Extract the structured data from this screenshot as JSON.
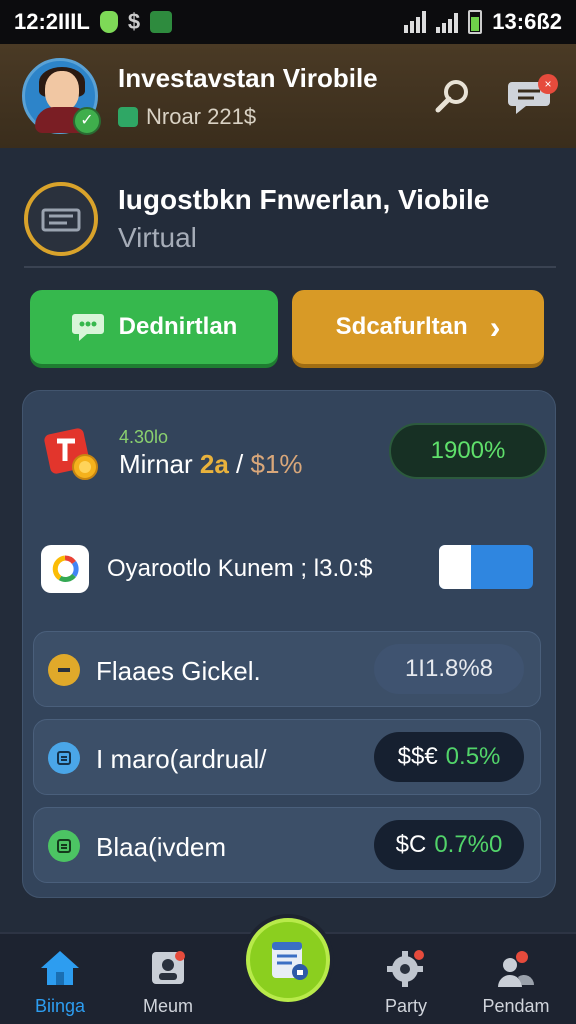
{
  "status_bar": {
    "time_left": "12:2IIIL",
    "time_right": "13:6ß2",
    "icons": [
      "shield-icon",
      "dollar-icon",
      "chart-icon",
      "wifi-signal-icon",
      "cell-signal-icon",
      "battery-icon"
    ]
  },
  "header": {
    "title": "Investavstan Virobile",
    "subtitle": "Nroar 221$",
    "icons": [
      "search-icon",
      "chat-icon"
    ],
    "chat_badge": "×"
  },
  "account": {
    "title": "Iugostbkn Fnwerlan, Viobile",
    "subtitle": "Virtual"
  },
  "actions": {
    "primary_label": "Dednirtlan",
    "secondary_label": "Sdcafurltan",
    "secondary_arrow": "›"
  },
  "card": {
    "row1": {
      "small": "4.30lo",
      "main_prefix": "Mirnar ",
      "main_accent": "2a",
      "main_sep": " / ",
      "main_suffix": "$1%",
      "pct": "1900%"
    },
    "row2": {
      "label": "Oyarootlo Kunem ; l3.0:$",
      "toggle_on": true
    },
    "list": [
      {
        "label": "Flaaes Gickel.",
        "value": "1I1.8%8",
        "style": "plain",
        "icon_color": "#e0a92a"
      },
      {
        "label": "I maro(ardrual/",
        "value_prefix": "$$€",
        "value_accent": "0.5%",
        "style": "dark",
        "icon_color": "#4aa6e8"
      },
      {
        "label": "Blaa(ivdem",
        "value_prefix": "$C",
        "value_accent": "0.7%0",
        "style": "dark",
        "icon_color": "#4cc463"
      }
    ]
  },
  "bottom_nav": {
    "items": [
      {
        "label": "Biinga",
        "icon": "home-icon",
        "active": true
      },
      {
        "label": "Meum",
        "icon": "inbox-icon",
        "active": false
      },
      {
        "label": "Party",
        "icon": "gear-icon",
        "active": false
      },
      {
        "label": "Pendam",
        "icon": "people-icon",
        "active": false
      }
    ],
    "fab_icon": "document-icon"
  },
  "colors": {
    "accent_green": "#36b84d",
    "accent_orange": "#d89a26",
    "active_nav": "#2d9df0"
  }
}
